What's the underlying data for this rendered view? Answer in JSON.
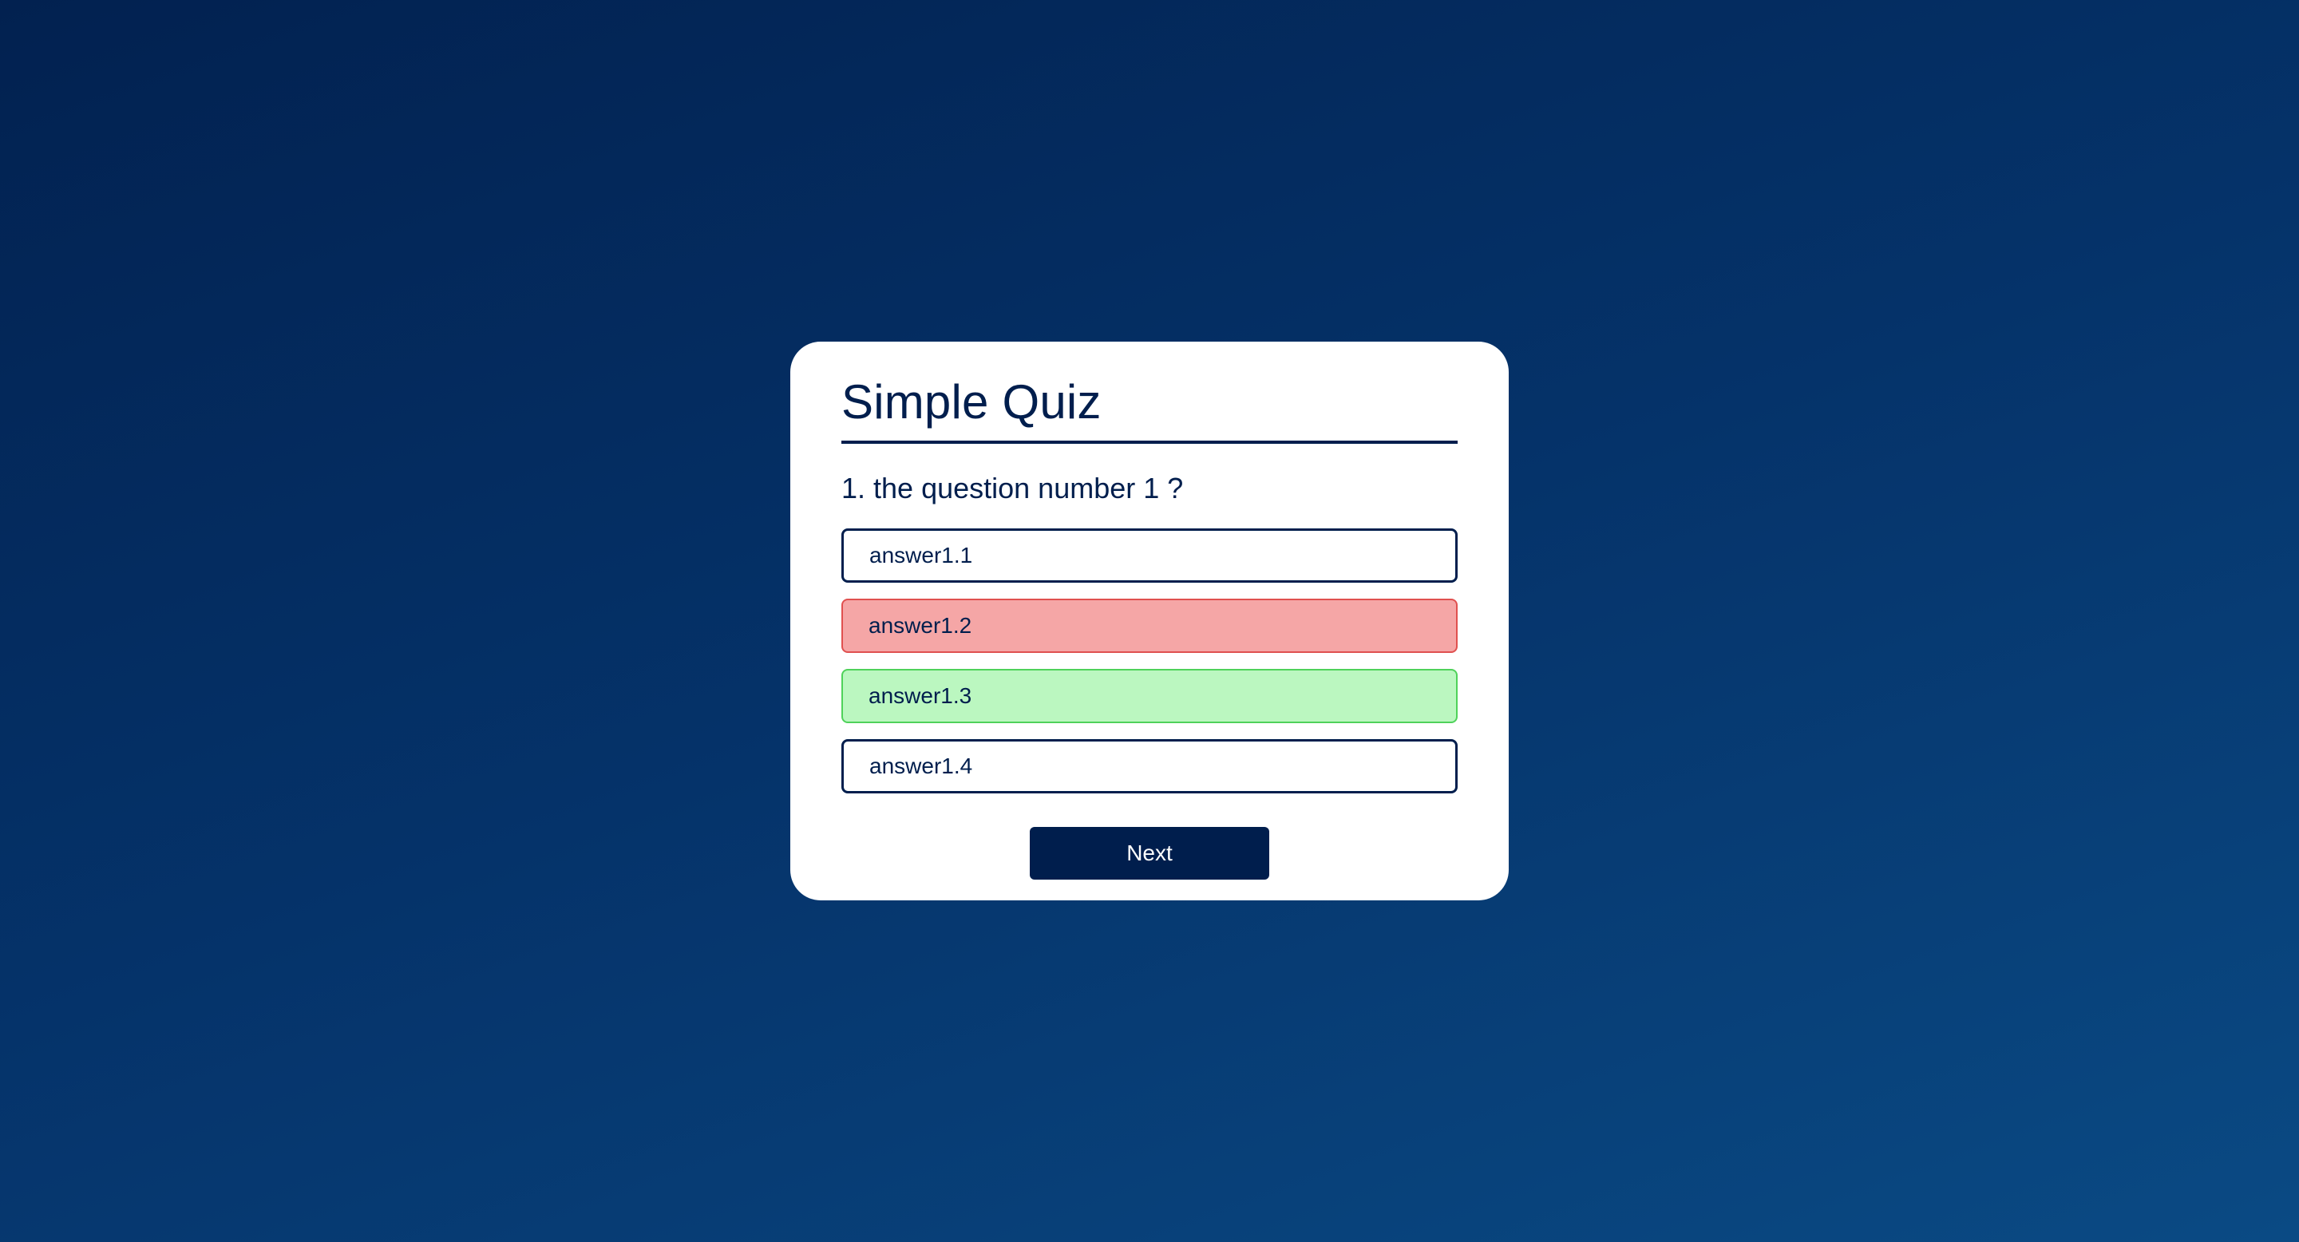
{
  "quiz": {
    "title": "Simple Quiz",
    "question": "1. the question number 1 ?",
    "answers": [
      {
        "label": "answer1.1",
        "state": "default"
      },
      {
        "label": "answer1.2",
        "state": "incorrect"
      },
      {
        "label": "answer1.3",
        "state": "correct"
      },
      {
        "label": "answer1.4",
        "state": "default"
      }
    ],
    "next_label": "Next"
  },
  "colors": {
    "primary": "#001e4d",
    "card_background": "#ffffff",
    "incorrect_fill": "#f5a6a6",
    "correct_fill": "#bbf7c0",
    "page_gradient_start": "#022150",
    "page_gradient_end": "#0a4a84"
  }
}
